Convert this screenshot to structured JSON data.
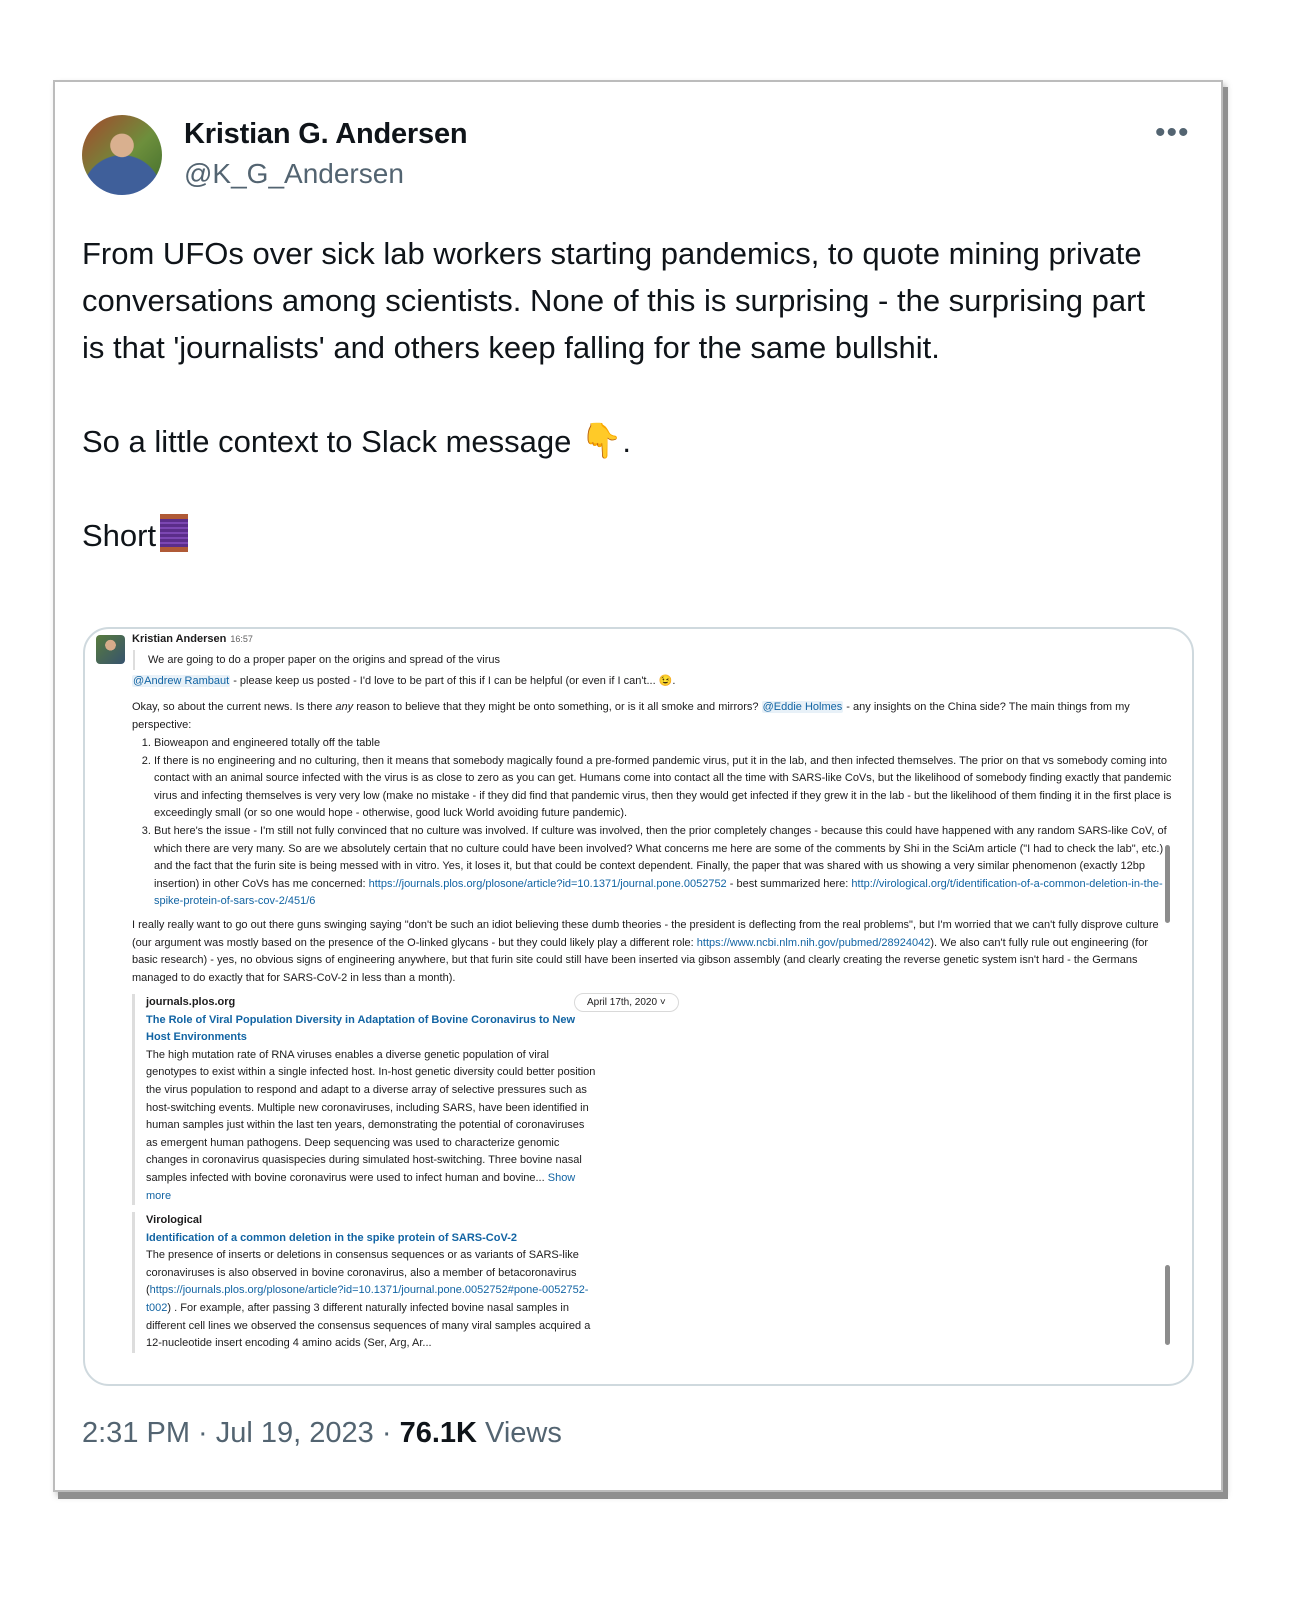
{
  "tweet": {
    "author_name": "Kristian G. Andersen",
    "author_handle": "@K_G_Andersen",
    "more_label": "•••",
    "paragraph1": "From UFOs over sick lab workers starting pandemics, to quote mining private conversations among scientists. None of this is surprising - the surprising part is that 'journalists' and others keep falling for the same bullshit.",
    "paragraph2": "So a little context to Slack message",
    "paragraph2_emoji": "👇",
    "paragraph2_end": ".",
    "paragraph3": "Short",
    "thread_emoji_name": "spool-of-thread-icon",
    "timestamp": "2:31 PM · Jul 19, 2023 · ",
    "views_count": "76.1K",
    "views_label": " Views"
  },
  "slack": {
    "author": "Kristian Andersen",
    "time": "16:57",
    "quote": "We are going to do a proper paper on the origins and spread of the virus",
    "line1_mention": "@Andrew Rambaut",
    "line1_text": " - please keep us posted - I'd love to be part of this if I can be helpful (or even if I can't... 😉.",
    "line2_a": "Okay, so about the current news. Is there ",
    "line2_em": "any",
    "line2_b": " reason to believe that they might be onto something, or is it all smoke and mirrors? ",
    "line2_mention": "@Eddie Holmes",
    "line2_c": " - any insights on the China side? The main things from my perspective:",
    "item1": "Bioweapon and engineered totally off the table",
    "item2": "If there is no engineering and no culturing, then it means that somebody magically found a pre-formed pandemic virus, put it in the lab, and then infected themselves. The prior on that vs somebody coming into contact with an animal source infected with the virus is as close to zero as you can get. Humans come into contact all the time with SARS-like CoVs, but the likelihood of somebody finding exactly that pandemic virus and infecting themselves is very very low (make no mistake - if they did find that pandemic virus, then they would get infected if they grew it in the lab - but the likelihood of them finding it in the first place is exceedingly small (or so one would hope - otherwise, good luck World avoiding future pandemic).",
    "item3_a": "But here's the issue - I'm still not fully convinced that no culture was involved. If culture was involved, then the prior completely changes - because this could have happened with any random SARS-like CoV, of which there are very many. So are we absolutely certain that no culture could have been involved? What concerns me here are some of the comments by Shi in the SciAm article (\"I had to check the lab\", etc.) and the fact that the furin site is being messed with in vitro. Yes, it loses it, but that could be context dependent. Finally, the paper that was shared with us showing a very similar phenomenon (exactly 12bp insertion) in other CoVs has me concerned: ",
    "item3_link1": "https://journals.plos.org/plosone/article?id=10.1371/journal.pone.0052752",
    "item3_b": " - best summarized here: ",
    "item3_link2": "http://virological.org/t/identification-of-a-common-deletion-in-the-spike-protein-of-sars-cov-2/451/6",
    "para_a": "I really really want to go out there guns swinging saying \"don't be such an idiot believing these dumb theories - the president is deflecting from the real problems\", but I'm worried that we can't fully disprove culture (our argument was mostly based on the presence of the O-linked glycans - but they could likely play a different role: ",
    "para_link": "https://www.ncbi.nlm.nih.gov/pubmed/28924042",
    "para_b": "). We also can't fully rule out engineering (for basic research) - yes, no obvious signs of engineering anywhere, but that furin site could still have been inserted via gibson assembly (and clearly creating the reverse genetic system isn't hard - the Germans managed to do exactly that for SARS-CoV-2 in less than a month).",
    "att1_site": "journals.plos.org",
    "att1_title": "The Role of Viral Population Diversity in Adaptation of Bovine Coronavirus to New Host Environments",
    "att1_body": "The high mutation rate of RNA viruses enables a diverse genetic population of viral genotypes to exist within a single infected host. In-host genetic diversity could better position the virus population to respond and adapt to a diverse array of selective pressures such as host-switching events. Multiple new coronaviruses, including SARS, have been identified in human samples just within the last ten years, demonstrating the potential of coronaviruses as emergent human pathogens. Deep sequencing was used to characterize genomic changes in coronavirus quasispecies during simulated host-switching. Three bovine nasal samples infected with bovine coronavirus were used to infect human and bovine...",
    "att1_more": "Show more",
    "att1_date": "April 17th, 2020 ˅",
    "att2_site": "Virological",
    "att2_title": "Identification of a common deletion in the spike protein of SARS-CoV-2",
    "att2_body_a": "The presence of inserts or deletions in consensus sequences or as variants of SARS-like coronaviruses is also observed in bovine coronavirus, also a member of betacoronavirus (",
    "att2_link": "https://journals.plos.org/plosone/article?id=10.1371/journal.pone.0052752#pone-0052752-t002",
    "att2_body_b": ") . For example, after passing 3 different naturally infected bovine nasal samples in different cell lines we observed the consensus sequences of many viral samples acquired a 12-nucleotide insert encoding 4 amino acids (Ser, Arg, Ar..."
  }
}
